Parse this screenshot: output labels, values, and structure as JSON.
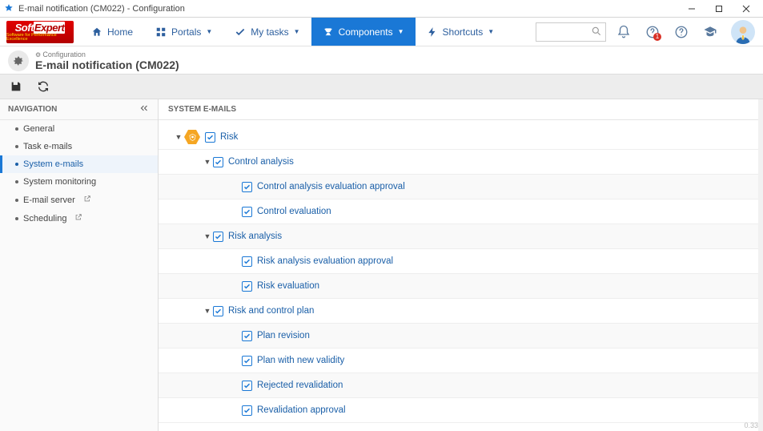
{
  "window": {
    "title": "E-mail notification (CM022) - Configuration"
  },
  "nav": {
    "home": "Home",
    "portals": "Portals",
    "mytasks": "My tasks",
    "components": "Components",
    "shortcuts": "Shortcuts"
  },
  "search": {
    "placeholder": ""
  },
  "alert_badge": "1",
  "breadcrumb": {
    "small": "Configuration",
    "title": "E-mail notification (CM022)"
  },
  "sidebar": {
    "header": "NAVIGATION",
    "items": [
      {
        "label": "General",
        "active": false,
        "ext": false
      },
      {
        "label": "Task e-mails",
        "active": false,
        "ext": false
      },
      {
        "label": "System e-mails",
        "active": true,
        "ext": false
      },
      {
        "label": "System monitoring",
        "active": false,
        "ext": false
      },
      {
        "label": "E-mail server",
        "active": false,
        "ext": true
      },
      {
        "label": "Scheduling",
        "active": false,
        "ext": true
      }
    ]
  },
  "main": {
    "header": "SYSTEM E-MAILS",
    "tree": [
      {
        "depth": 0,
        "arrow": true,
        "hex": true,
        "label": "Risk",
        "alt": false
      },
      {
        "depth": 1,
        "arrow": true,
        "hex": false,
        "label": "Control analysis",
        "alt": false
      },
      {
        "depth": 2,
        "arrow": false,
        "hex": false,
        "label": "Control analysis evaluation approval",
        "alt": true
      },
      {
        "depth": 2,
        "arrow": false,
        "hex": false,
        "label": "Control evaluation",
        "alt": false
      },
      {
        "depth": 1,
        "arrow": true,
        "hex": false,
        "label": "Risk analysis",
        "alt": true
      },
      {
        "depth": 2,
        "arrow": false,
        "hex": false,
        "label": "Risk analysis evaluation approval",
        "alt": false
      },
      {
        "depth": 2,
        "arrow": false,
        "hex": false,
        "label": "Risk evaluation",
        "alt": true
      },
      {
        "depth": 1,
        "arrow": true,
        "hex": false,
        "label": "Risk and control plan",
        "alt": false
      },
      {
        "depth": 2,
        "arrow": false,
        "hex": false,
        "label": "Plan revision",
        "alt": true
      },
      {
        "depth": 2,
        "arrow": false,
        "hex": false,
        "label": "Plan with new validity",
        "alt": false
      },
      {
        "depth": 2,
        "arrow": false,
        "hex": false,
        "label": "Rejected revalidation",
        "alt": true
      },
      {
        "depth": 2,
        "arrow": false,
        "hex": false,
        "label": "Revalidation approval",
        "alt": false
      }
    ]
  },
  "footer_version": "0.33"
}
